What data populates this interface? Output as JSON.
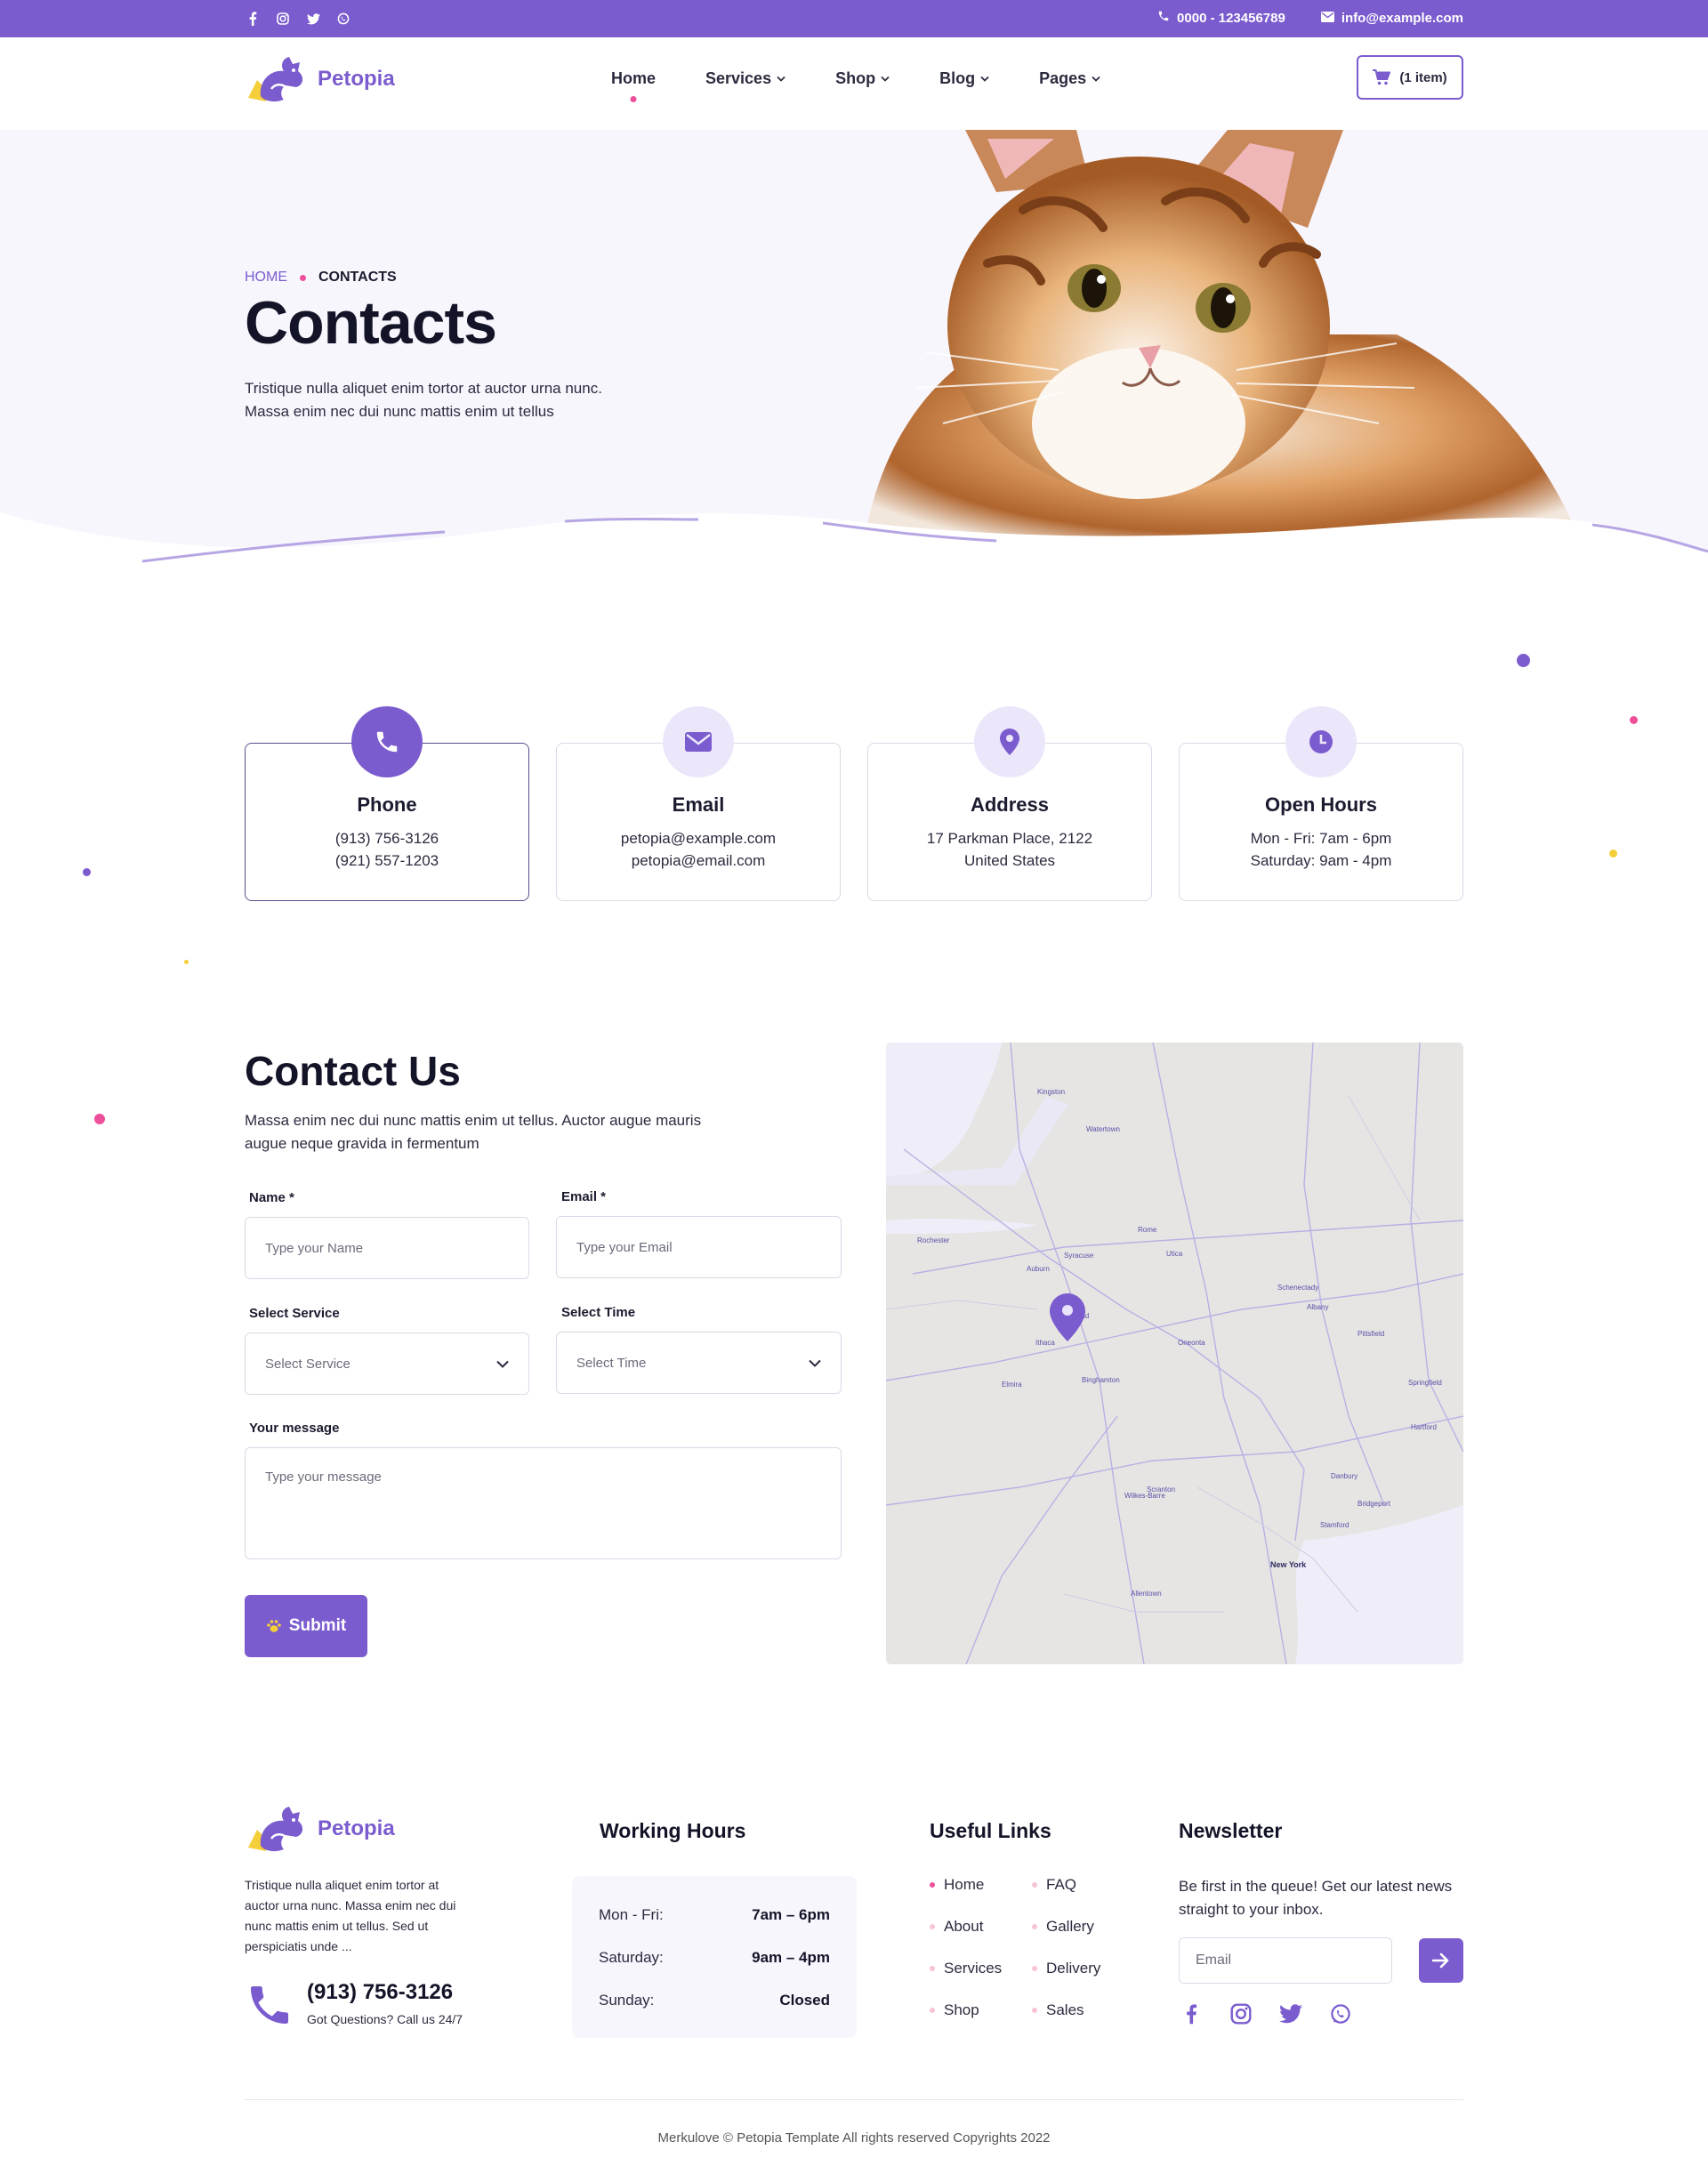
{
  "colors": {
    "primary": "#7b5cce",
    "accent_pink": "#ee4f9b",
    "accent_yellow": "#f5cf3a",
    "hero_bg": "#f8f6fd",
    "text_dark": "#141428"
  },
  "topbar": {
    "social_icons": [
      "facebook-icon",
      "instagram-icon",
      "twitter-icon",
      "whatsapp-icon"
    ],
    "phone": "0000 - 123456789",
    "email": "info@example.com"
  },
  "header": {
    "brand": "Petopia",
    "nav": [
      {
        "label": "Home",
        "active": true,
        "dropdown": false
      },
      {
        "label": "Services",
        "dropdown": true
      },
      {
        "label": "Shop",
        "dropdown": true
      },
      {
        "label": "Blog",
        "dropdown": true
      },
      {
        "label": "Pages",
        "dropdown": true
      }
    ],
    "cart_label": "(1 item)"
  },
  "hero": {
    "breadcrumb_home": "HOME",
    "breadcrumb_current": "CONTACTS",
    "title": "Contacts",
    "lead_line1": "Tristique nulla aliquet enim tortor at auctor urna nunc.",
    "lead_line2": "Massa enim nec dui nunc mattis enim ut tellus"
  },
  "info_cards": [
    {
      "title": "Phone",
      "line1": "(913) 756-3126",
      "line2": "(921) 557-1203",
      "icon": "phone-icon",
      "active": true
    },
    {
      "title": "Email",
      "line1": "petopia@example.com",
      "line2": "petopia@email.com",
      "icon": "envelope-icon"
    },
    {
      "title": "Address",
      "line1": "17 Parkman Place, 2122",
      "line2": "United States",
      "icon": "map-pin-icon"
    },
    {
      "title": "Open Hours",
      "line1": "Mon - Fri: 7am - 6pm",
      "line2": "Saturday: 9am - 4pm",
      "icon": "clock-icon"
    }
  ],
  "contact": {
    "title": "Contact Us",
    "lead_line1": "Massa enim nec dui nunc mattis enim ut tellus. Auctor augue mauris",
    "lead_line2": "augue neque gravida in fermentum",
    "name_label": "Name *",
    "name_placeholder": "Type your Name",
    "email_label": "Email *",
    "email_placeholder": "Type your Email",
    "service_label": "Select Service",
    "service_value": "Select Service",
    "time_label": "Select Time",
    "time_value": "Select Time",
    "message_label": "Your message",
    "message_placeholder": "Type your message",
    "submit_label": "Submit"
  },
  "map": {
    "cities": [
      "Kingston",
      "Watertown",
      "Syracuse",
      "Utica",
      "Rochester",
      "Ithaca",
      "Binghamton",
      "Albany",
      "Schenectady",
      "Oneonta",
      "Scranton",
      "Allentown",
      "New York",
      "Hartford",
      "Springfield",
      "Bridgeport",
      "Stamford",
      "Danbury",
      "Pittsfield",
      "Wilkes-Barre",
      "Elmira",
      "Cortland",
      "Rome",
      "Auburn"
    ]
  },
  "footer": {
    "brand": "Petopia",
    "about_line1": "Tristique nulla aliquet enim tortor at",
    "about_line2": "auctor urna nunc. Massa enim nec dui",
    "about_line3": "nunc mattis enim ut tellus. Sed ut",
    "about_line4": "perspiciatis unde ...",
    "phone": "(913) 756-3126",
    "phone_sub": "Got Questions? Call us 24/7",
    "hours_title": "Working Hours",
    "hours": [
      {
        "day": "Mon - Fri:",
        "time": "7am – 6pm"
      },
      {
        "day": "Saturday:",
        "time": "9am – 4pm"
      },
      {
        "day": "Sunday:",
        "time": "Closed"
      }
    ],
    "links_title": "Useful Links",
    "links": [
      "Home",
      "FAQ",
      "About",
      "Gallery",
      "Services",
      "Delivery",
      "Shop",
      "Sales"
    ],
    "newsletter_title": "Newsletter",
    "newsletter_line1": "Be first in the queue! Get our latest news",
    "newsletter_line2": "straight to your inbox.",
    "newsletter_placeholder": "Email",
    "social_icons": [
      "facebook-icon",
      "instagram-icon",
      "twitter-icon",
      "whatsapp-icon"
    ],
    "copyright": "Merkulove © Petopia Template All rights reserved Copyrights 2022"
  }
}
